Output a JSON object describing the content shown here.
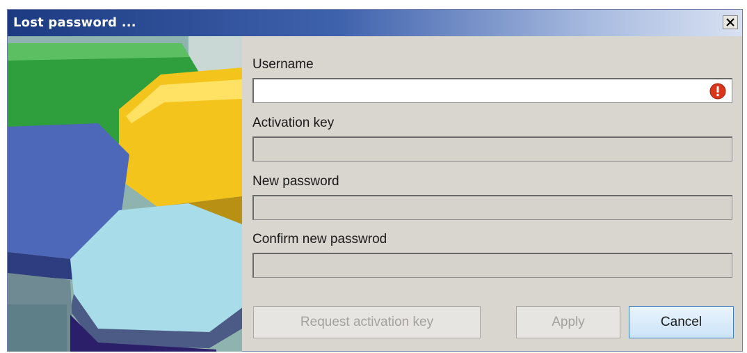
{
  "window": {
    "title": "Lost password ..."
  },
  "form": {
    "username": {
      "label": "Username",
      "value": ""
    },
    "activation_key": {
      "label": "Activation key",
      "value": ""
    },
    "new_password": {
      "label": "New password",
      "value": ""
    },
    "confirm_password": {
      "label": "Confirm new passwrod",
      "value": ""
    }
  },
  "buttons": {
    "request_label": "Request activation key",
    "apply_label": "Apply",
    "cancel_label": "Cancel"
  },
  "icons": {
    "close": "close-icon",
    "error": "error-icon",
    "sidebar_art": "hexagon-graphic"
  },
  "colors": {
    "title_bar": "#1c3a80",
    "error": "#d9361b",
    "cancel_border": "#3f7fc4"
  }
}
